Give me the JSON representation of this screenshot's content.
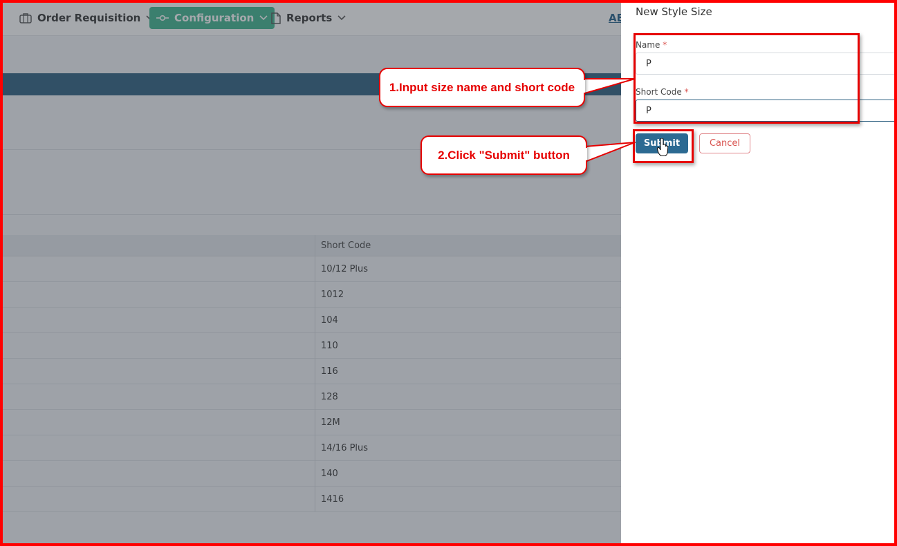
{
  "nav": {
    "items": [
      {
        "label": "Order Requisition",
        "icon": "briefcase-icon"
      },
      {
        "label": "Configuration",
        "icon": "commit-icon"
      },
      {
        "label": "Reports",
        "icon": "document-icon"
      }
    ],
    "right_link": "AB"
  },
  "table": {
    "column_header": "Short Code",
    "rows": [
      "10/12 Plus",
      "1012",
      "104",
      "110",
      "116",
      "128",
      "12M",
      "14/16 Plus",
      "140",
      "1416"
    ]
  },
  "panel": {
    "title": "New Style Size",
    "name_label": "Name",
    "name_value": "P",
    "short_code_label": "Short Code",
    "short_code_value": "P",
    "required_marker": "*",
    "submit_label": "Submit",
    "cancel_label": "Cancel"
  },
  "annotations": {
    "step1": "1.Input size name and short code",
    "step2": "2.Click \"Submit\" button"
  },
  "colors": {
    "accent": "#3fb48e",
    "primary": "#2c6a92",
    "annotation": "#e60000"
  }
}
